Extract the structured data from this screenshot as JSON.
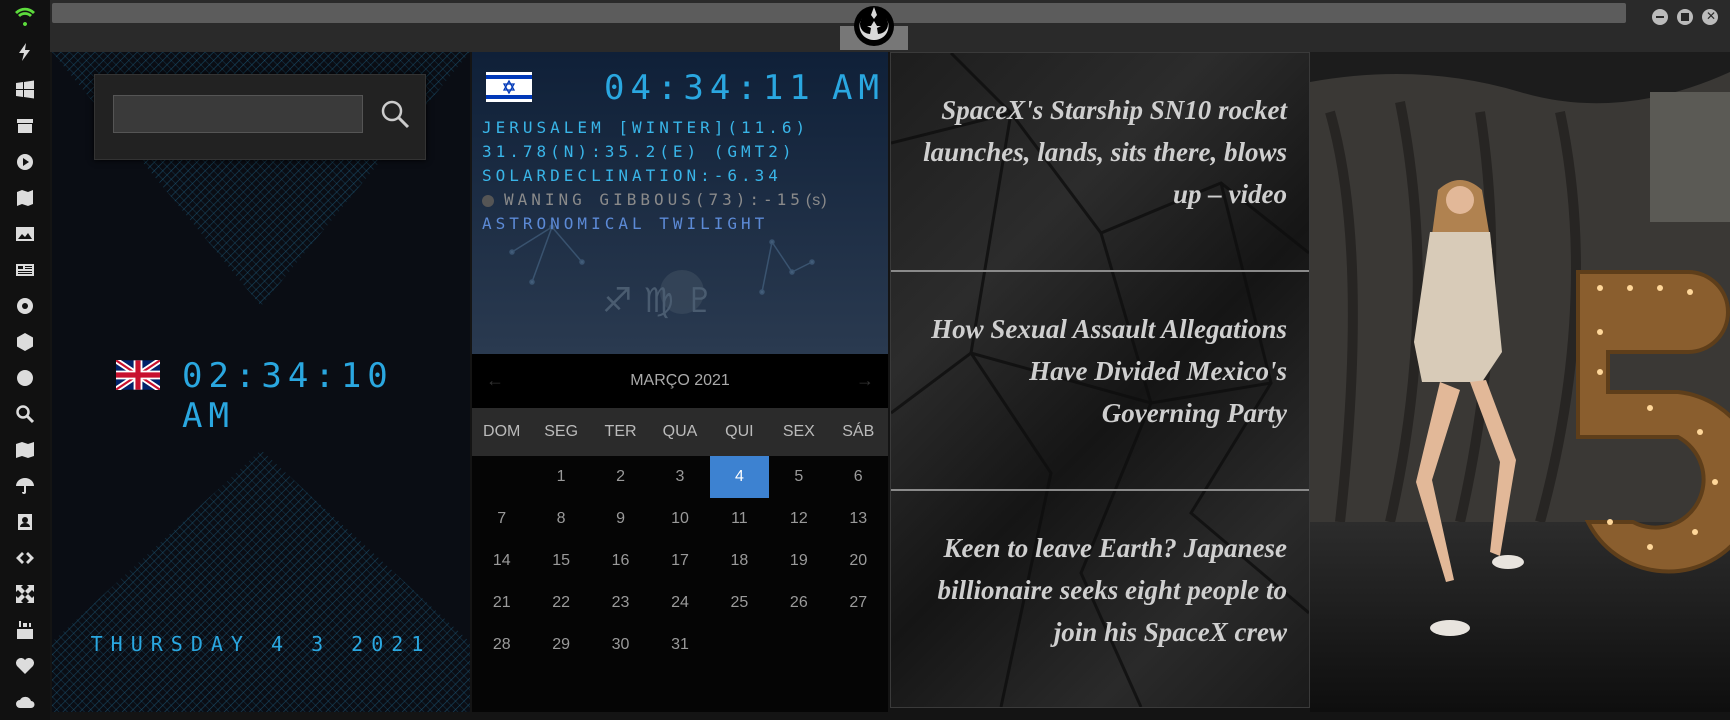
{
  "rail": {
    "icons": [
      "wifi-icon",
      "lightning-icon",
      "windows-icon",
      "archive-icon",
      "play-icon",
      "maps-book-icon",
      "image-icon",
      "news-icon",
      "settings-icon",
      "hexagon-icon",
      "globe-icon",
      "search-icon",
      "map-icon",
      "umbrella-icon",
      "contacts-icon",
      "code-icon",
      "expand-icon",
      "youtube-icon",
      "heart-icon",
      "cloud-icon"
    ]
  },
  "uk_clock": {
    "time": "02:34:10 AM",
    "date": "THURSDAY 4 3 2021"
  },
  "search": {
    "value": "",
    "placeholder": ""
  },
  "israel_clock": {
    "time": "04:34:11",
    "ampm": "AM",
    "line1": "JERUSALEM [WINTER](11.6)",
    "line2": "31.78(N):35.2(E) (GMT2)",
    "line3": "SOLARDECLINATION:-6.34",
    "line4": "WANING GIBBOUS(73):-15",
    "line4_unit": "(s)",
    "line5": "ASTRONOMICAL TWILIGHT"
  },
  "calendar": {
    "month": "MARÇO 2021",
    "weekdays": [
      "DOM",
      "SEG",
      "TER",
      "QUA",
      "QUI",
      "SEX",
      "SÁB"
    ],
    "weeks": [
      [
        "",
        "1",
        "2",
        "3",
        "4",
        "5",
        "6"
      ],
      [
        "7",
        "8",
        "9",
        "10",
        "11",
        "12",
        "13"
      ],
      [
        "14",
        "15",
        "16",
        "17",
        "18",
        "19",
        "20"
      ],
      [
        "21",
        "22",
        "23",
        "24",
        "25",
        "26",
        "27"
      ],
      [
        "28",
        "29",
        "30",
        "31",
        "",
        "",
        ""
      ]
    ],
    "today": "4",
    "prev": "←",
    "next": "→"
  },
  "news": [
    "SpaceX's Starship SN10 rocket launches, lands, sits there, blows up – video",
    "How Sexual Assault Allegations Have Divided Mexico's Governing Party",
    "Keen to leave Earth? Japanese billionaire seeks eight people to join his SpaceX crew"
  ],
  "colors": {
    "accent": "#2aa7e0",
    "today": "#3d82d1",
    "twilight": "#5c8ad6"
  }
}
